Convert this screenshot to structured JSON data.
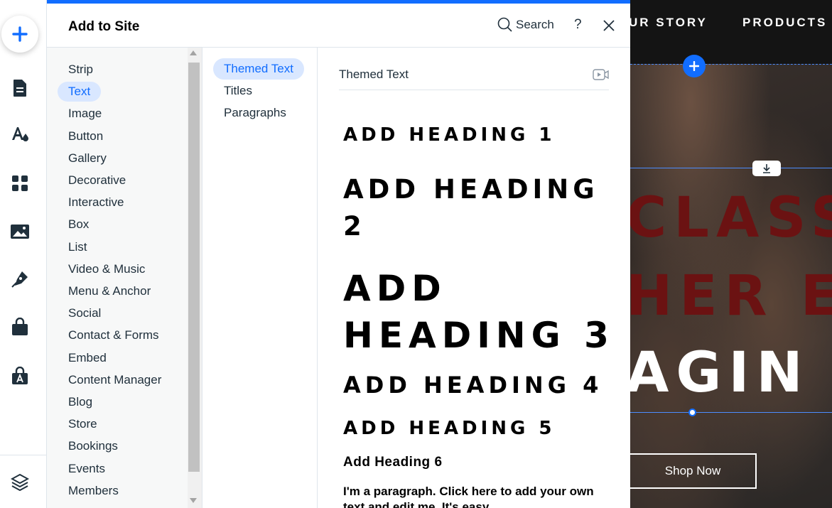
{
  "rail": {
    "tools": [
      "add",
      "pages",
      "design",
      "apps",
      "media",
      "pen",
      "store",
      "portfolio",
      "layers"
    ]
  },
  "panel": {
    "title": "Add to Site",
    "search_label": "Search",
    "help_label": "?"
  },
  "categories": [
    {
      "label": "Strip",
      "active": false
    },
    {
      "label": "Text",
      "active": true
    },
    {
      "label": "Image",
      "active": false
    },
    {
      "label": "Button",
      "active": false
    },
    {
      "label": "Gallery",
      "active": false
    },
    {
      "label": "Decorative",
      "active": false
    },
    {
      "label": "Interactive",
      "active": false
    },
    {
      "label": "Box",
      "active": false
    },
    {
      "label": "List",
      "active": false
    },
    {
      "label": "Video & Music",
      "active": false
    },
    {
      "label": "Menu & Anchor",
      "active": false
    },
    {
      "label": "Social",
      "active": false
    },
    {
      "label": "Contact & Forms",
      "active": false
    },
    {
      "label": "Embed",
      "active": false
    },
    {
      "label": "Content Manager",
      "active": false
    },
    {
      "label": "Blog",
      "active": false
    },
    {
      "label": "Store",
      "active": false
    },
    {
      "label": "Bookings",
      "active": false
    },
    {
      "label": "Events",
      "active": false
    },
    {
      "label": "Members",
      "active": false
    }
  ],
  "subcategories": [
    {
      "label": "Themed Text",
      "active": true
    },
    {
      "label": "Titles",
      "active": false
    },
    {
      "label": "Paragraphs",
      "active": false
    }
  ],
  "content": {
    "section_title": "Themed Text",
    "h1": "Add Heading 1",
    "h2": "Add Heading 2",
    "h3": "Add Heading 3",
    "h4": "Add Heading 4",
    "h5": "Add Heading 5",
    "h6": "Add Heading 6",
    "paragraph": "I'm a paragraph. Click here to add your own text and edit me. It's easy."
  },
  "site": {
    "nav_items": [
      "UR STORY",
      "PRODUCTS"
    ],
    "line1": "CLASS",
    "line2": "HER E",
    "line3": "AGIN",
    "cta": "Shop Now"
  },
  "colors": {
    "accent": "#116dff",
    "active_bg": "#d9e7ff",
    "hero_red": "#6b1212"
  }
}
